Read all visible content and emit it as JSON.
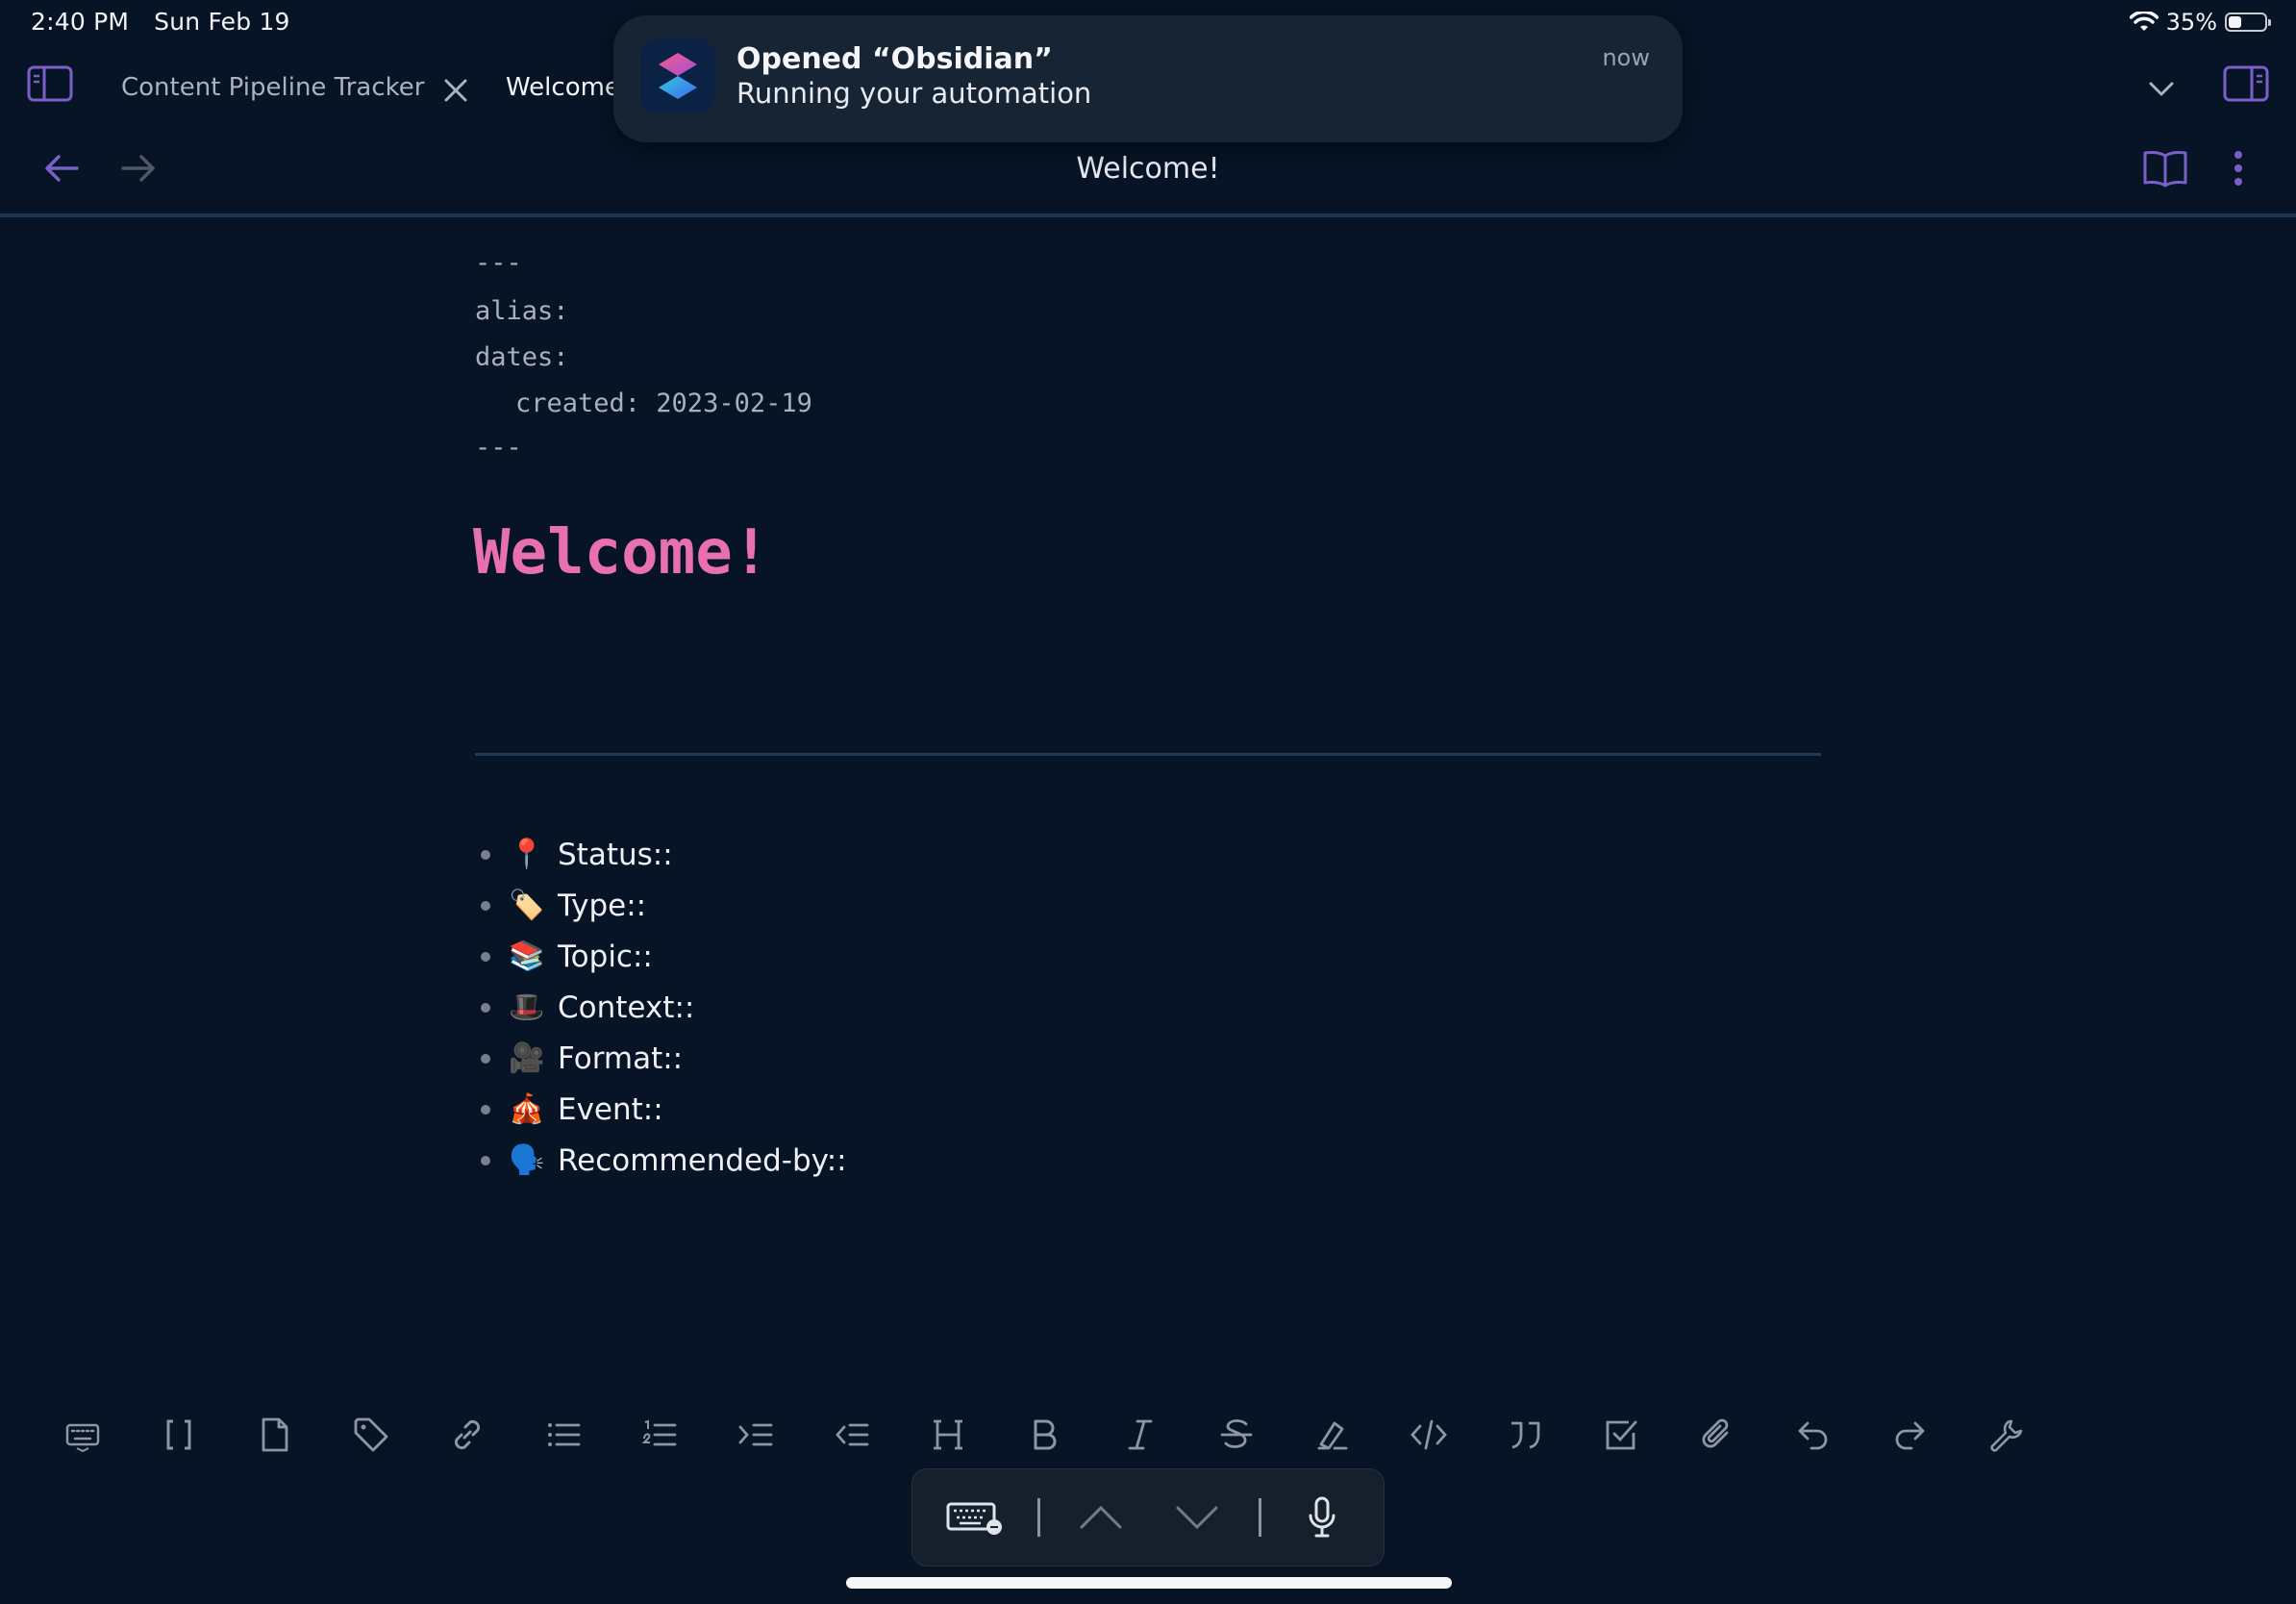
{
  "status_bar": {
    "time": "2:40 PM",
    "date": "Sun Feb 19",
    "battery": "35%",
    "battery_level": 0.35
  },
  "tabs": [
    {
      "label": "Content Pipeline Tracker"
    },
    {
      "label": "Welcome"
    }
  ],
  "notification": {
    "title": "Opened “Obsidian”",
    "body": "Running your automation",
    "time": "now",
    "icon": "shortcuts-icon"
  },
  "header": {
    "title": "Welcome!"
  },
  "frontmatter": {
    "open": "---",
    "alias": "alias:",
    "dates": "dates:",
    "created": "created: 2023-02-19",
    "close": "---"
  },
  "document": {
    "heading": "Welcome!",
    "properties": [
      {
        "emoji": "📍",
        "label": "Status::"
      },
      {
        "emoji": "🏷️",
        "label": "Type::"
      },
      {
        "emoji": "📚",
        "label": "Topic::"
      },
      {
        "emoji": "🎩",
        "label": "Context::"
      },
      {
        "emoji": "🎥",
        "label": "Format::"
      },
      {
        "emoji": "🎪",
        "label": "Event::"
      },
      {
        "emoji": "🗣️",
        "label": "Recommended-by::"
      }
    ]
  },
  "toolbar": {
    "icons": [
      "keyboard-icon",
      "brackets-icon",
      "file-icon",
      "tag-icon",
      "link-icon",
      "bullet-list-icon",
      "numbered-list-icon",
      "indent-icon",
      "outdent-icon",
      "heading-icon",
      "bold-icon",
      "italic-icon",
      "strikethrough-icon",
      "highlight-icon",
      "code-icon",
      "quote-icon",
      "checkbox-icon",
      "attachment-icon",
      "undo-icon",
      "redo-icon",
      "wrench-icon"
    ]
  },
  "colors": {
    "background": "#061426",
    "accent": "#7b5fc8",
    "heading": "#e86fb2",
    "divider": "#1c3551"
  }
}
